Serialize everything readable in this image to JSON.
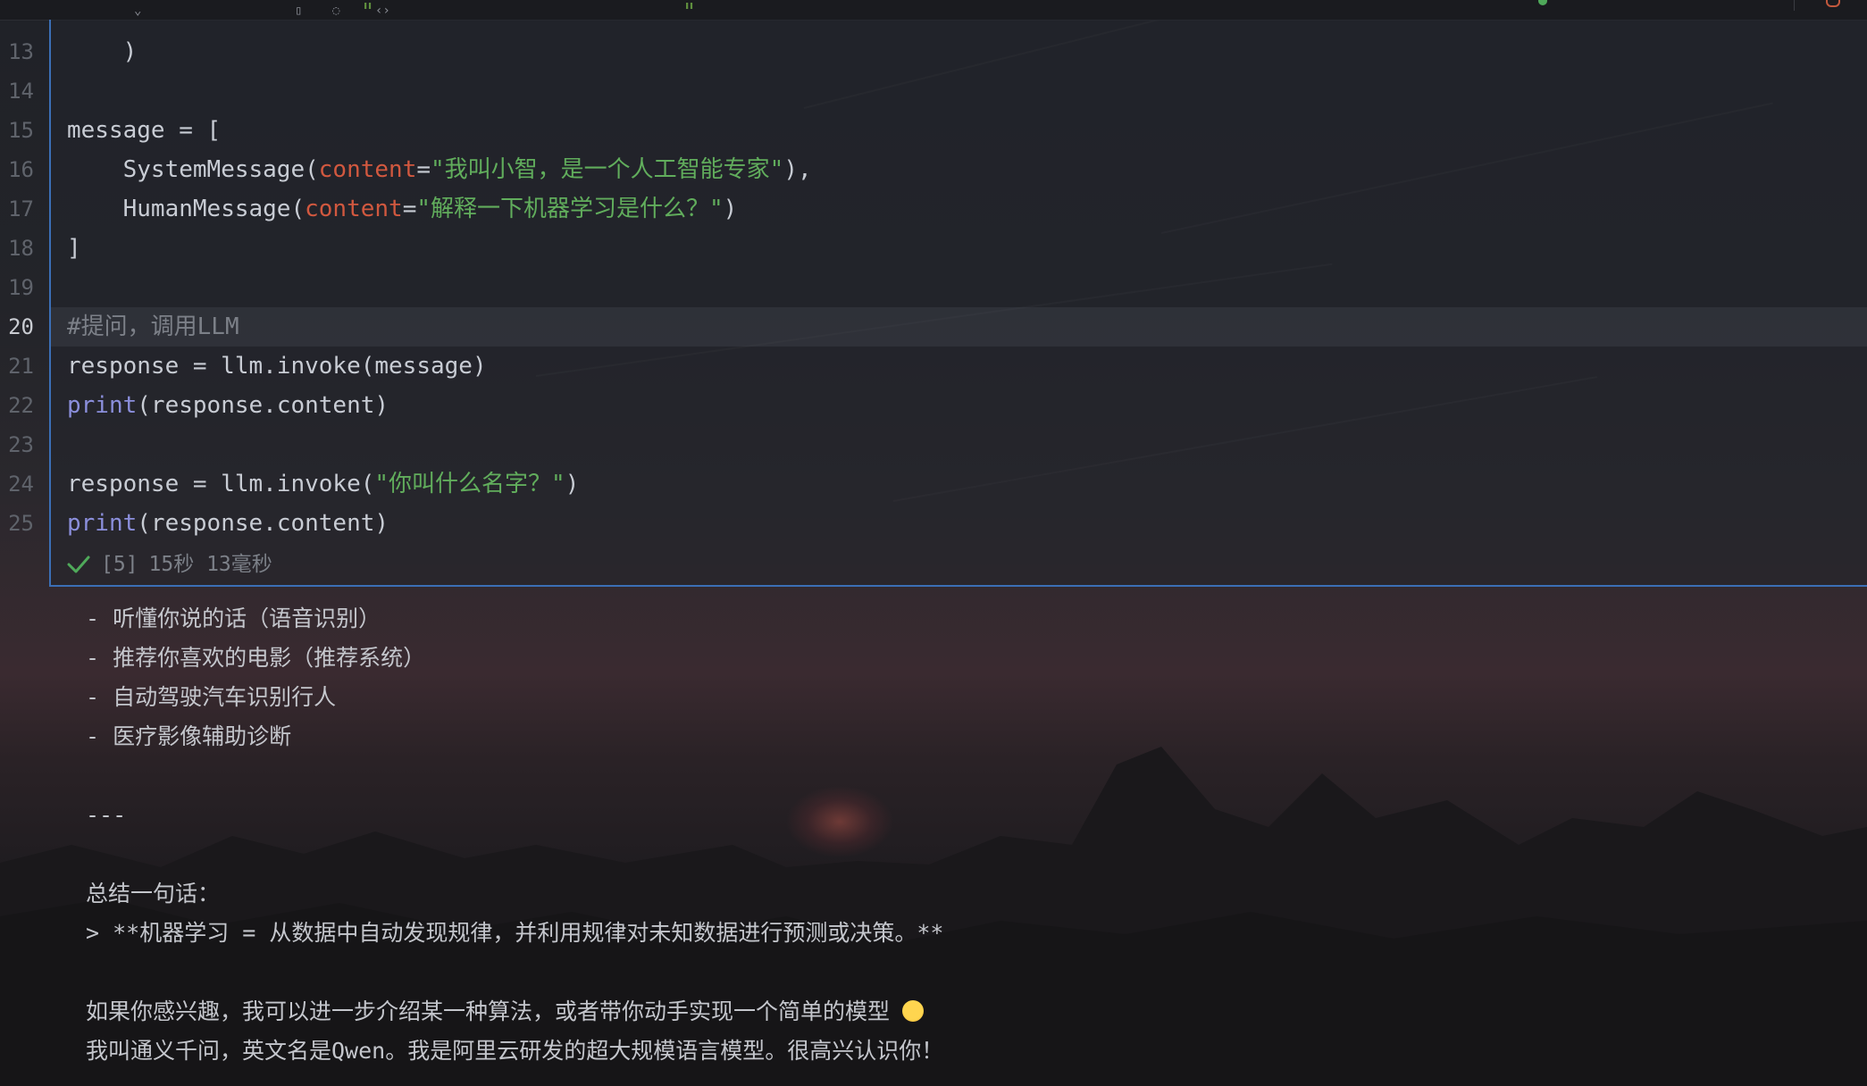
{
  "editor": {
    "top_cut_line": "                     \"                      \"",
    "line_numbers": [
      "13",
      "14",
      "15",
      "16",
      "17",
      "18",
      "19",
      "20",
      "21",
      "22",
      "23",
      "24",
      "25"
    ],
    "active_line": "20",
    "lines": {
      "l13": ")",
      "l15": "message = [",
      "l16_fn": "SystemMessage(",
      "l16_param": "content",
      "l16_eq": "=",
      "l16_str": "\"我叫小智，是一个人工智能专家\"",
      "l16_end": "),",
      "l17_fn": "HumanMessage(",
      "l17_param": "content",
      "l17_eq": "=",
      "l17_str": "\"解释一下机器学习是什么？\"",
      "l17_end": ")",
      "l18": "]",
      "l20_comment": "#提问，调用LLM",
      "l21": "response = llm.invoke(message)",
      "l22_kw": "print",
      "l22_rest": "(response.content)",
      "l24_pre": "response = llm.invoke(",
      "l24_str": "\"你叫什么名字？\"",
      "l24_end": ")",
      "l25_kw": "print",
      "l25_rest": "(response.content)"
    },
    "execution": {
      "count": "[5]",
      "duration": "15秒 13毫秒",
      "status_icon": "check-icon"
    }
  },
  "output": {
    "lines": [
      "- 听懂你说的话（语音识别）",
      "- 推荐你喜欢的电影（推荐系统）",
      "- 自动驾驶汽车识别行人",
      "- 医疗影像辅助诊断",
      "---",
      "总结一句话：",
      "> **机器学习 = 从数据中自动发现规律，并利用规律对未知数据进行预测或决策。**",
      "如果你感兴趣，我可以进一步介绍某一种算法，或者带你动手实现一个简单的模型",
      "我叫通义千问，英文名是Qwen。我是阿里云研发的超大规模语言模型。很高兴认识你！"
    ],
    "emoji": "smiling-face-emoji"
  },
  "colors": {
    "cell_border": "#3b6fb6",
    "string": "#61ad5c",
    "param": "#d1583f",
    "builtin": "#8b8fdc",
    "comment": "#7c8088"
  }
}
